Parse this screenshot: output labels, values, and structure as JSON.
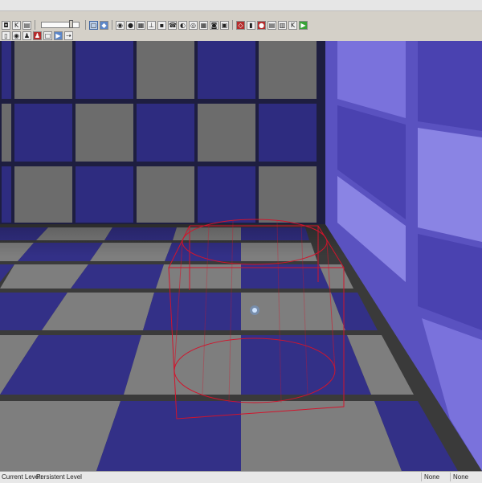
{
  "toolbar_top": {
    "buttons": [
      {
        "name": "camera-icon",
        "glyph": "◘"
      },
      {
        "name": "kismet-icon",
        "glyph": "K"
      },
      {
        "name": "content-browser-icon",
        "glyph": "▤"
      }
    ],
    "buttons_right": [
      {
        "name": "translate-mode-icon",
        "glyph": "▢"
      },
      {
        "name": "rotate-mode-icon",
        "glyph": "◆"
      },
      {
        "name": "scale-mode-icon",
        "glyph": "◉"
      },
      {
        "name": "world-icon",
        "glyph": "●"
      },
      {
        "name": "grid-snap-icon",
        "glyph": "▦"
      },
      {
        "name": "angle-snap-icon",
        "glyph": "⊥"
      },
      {
        "name": "vertex-snap-icon",
        "glyph": "▪"
      },
      {
        "name": "sound-icon",
        "glyph": "☎"
      },
      {
        "name": "light-icon",
        "glyph": "◐"
      },
      {
        "name": "particle-icon",
        "glyph": "◎"
      },
      {
        "name": "material-icon",
        "glyph": "▦"
      },
      {
        "name": "terrain-icon",
        "glyph": "◙"
      },
      {
        "name": "geometry-icon",
        "glyph": "▣"
      },
      {
        "name": "group-icon",
        "glyph": "◇"
      },
      {
        "name": "matinee-icon",
        "glyph": "▮"
      },
      {
        "name": "record-icon",
        "glyph": "●"
      },
      {
        "name": "build-icon",
        "glyph": "▤"
      },
      {
        "name": "build-lighting-icon",
        "glyph": "▥"
      },
      {
        "name": "kismet-editor-icon",
        "glyph": "K"
      },
      {
        "name": "play-in-editor-icon",
        "glyph": "▶"
      }
    ]
  },
  "toolbar_bottom": {
    "buttons": [
      {
        "name": "lock-icon",
        "glyph": "▯"
      },
      {
        "name": "eye-icon",
        "glyph": "◉"
      },
      {
        "name": "actor-icon",
        "glyph": "♟"
      },
      {
        "name": "selected-actor-icon",
        "glyph": "♟"
      },
      {
        "name": "viewport-icon",
        "glyph": "□"
      },
      {
        "name": "realtime-play-icon",
        "glyph": "▶"
      },
      {
        "name": "runner-icon",
        "glyph": "⇢"
      }
    ]
  },
  "colors": {
    "floor_blue": "#333087",
    "floor_gray": "#7e7e7e",
    "wall_blue": "#2e2c80",
    "wall_gray": "#6c6c6c",
    "right_wall": "#6e66d6",
    "wireframe": "#d2142c",
    "light_dot": "#6aa8ff"
  },
  "status": {
    "label": "Current Level:",
    "level": "Persistent Level",
    "cell_1": "None",
    "cell_2": "None"
  }
}
